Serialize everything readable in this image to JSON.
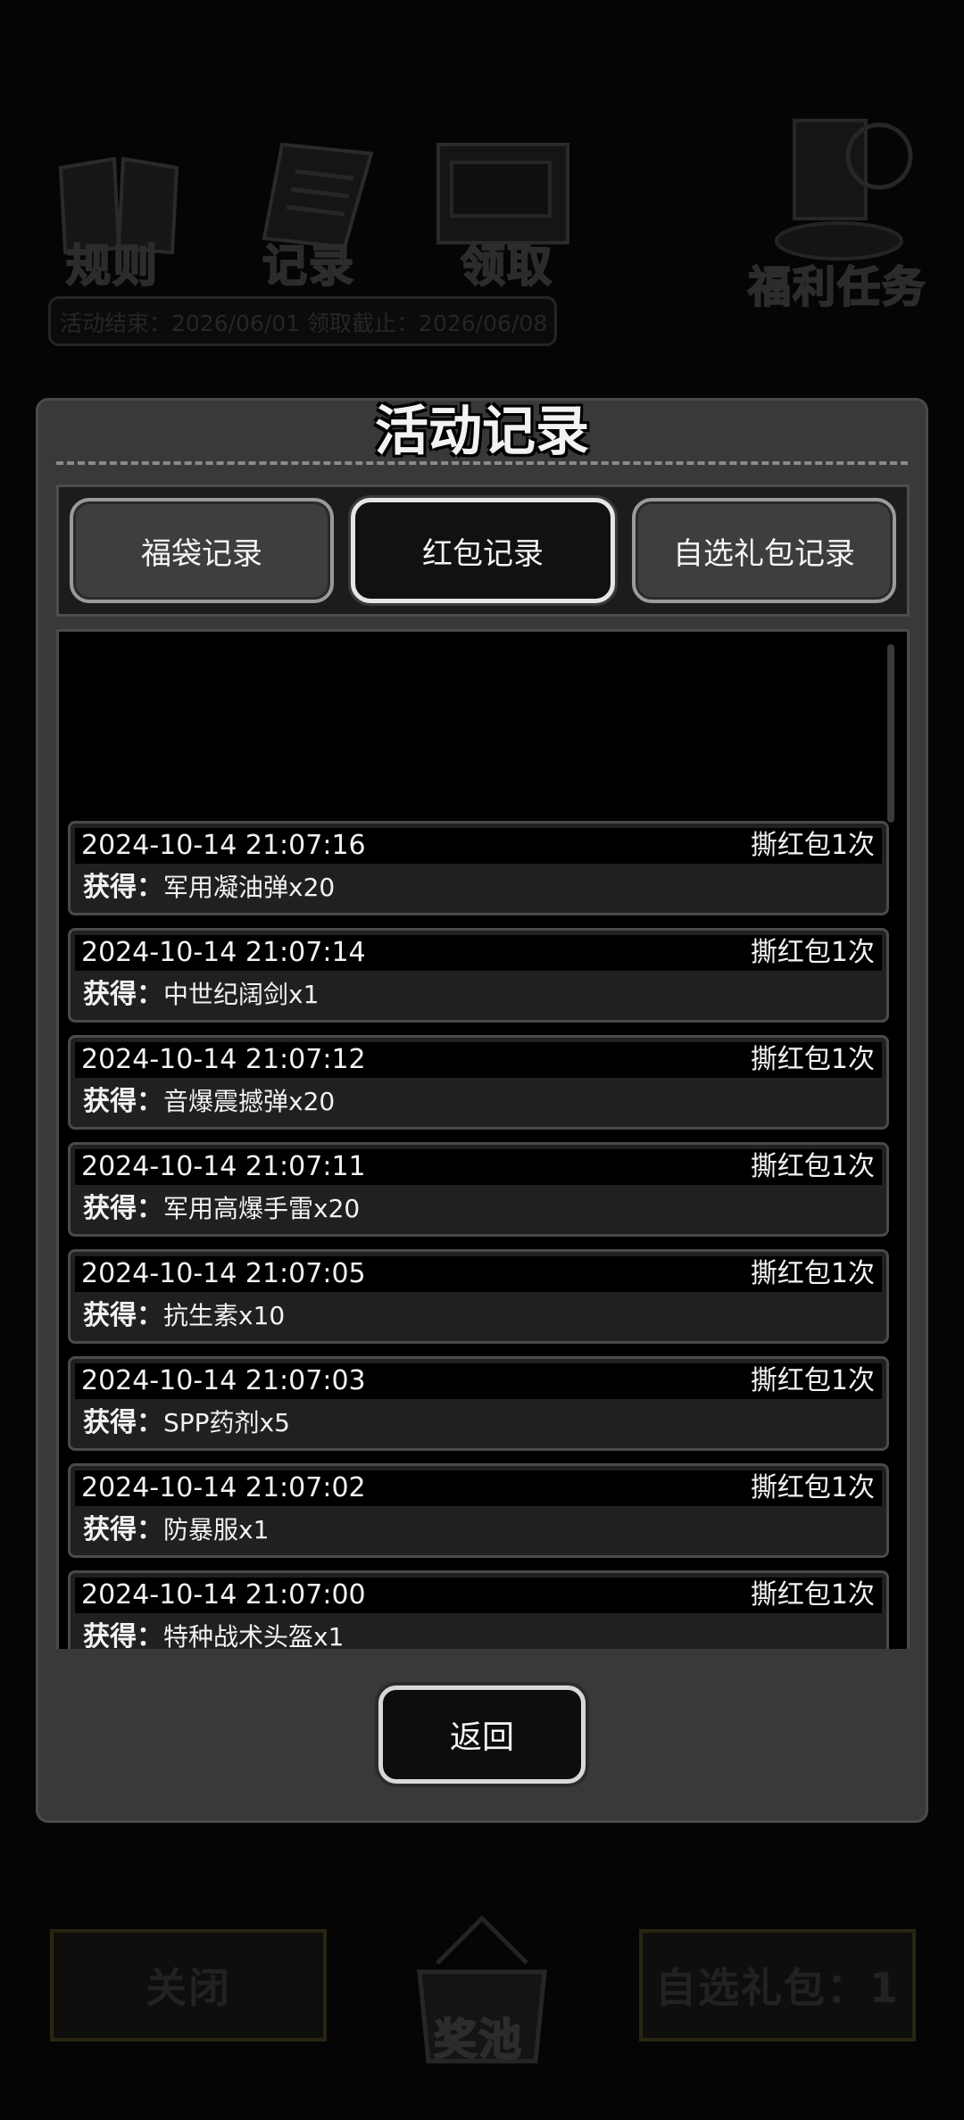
{
  "background": {
    "top_icons": [
      {
        "label": "规则",
        "icon": "book-icon"
      },
      {
        "label": "记录",
        "icon": "clipboard-icon"
      },
      {
        "label": "领取",
        "icon": "printer-icon"
      }
    ],
    "welfare_task_label": "福利任务",
    "dates_text": "活动结束：2026/06/01  领取截止：2026/06/08",
    "close_label": "关闭",
    "prize_pool_label": "奖池",
    "optional_gift_label": "自选礼包：1"
  },
  "modal": {
    "title": "活动记录",
    "tabs": [
      {
        "label": "福袋记录",
        "active": false
      },
      {
        "label": "红包记录",
        "active": true
      },
      {
        "label": "自选礼包记录",
        "active": false
      }
    ],
    "obtain_label": "获得",
    "obtain_separator": "：",
    "records": [
      {
        "time": "2024-10-14 21:07:16",
        "action": "撕红包1次",
        "item": "军用凝油弹x20"
      },
      {
        "time": "2024-10-14 21:07:14",
        "action": "撕红包1次",
        "item": "中世纪阔剑x1"
      },
      {
        "time": "2024-10-14 21:07:12",
        "action": "撕红包1次",
        "item": "音爆震撼弹x20"
      },
      {
        "time": "2024-10-14 21:07:11",
        "action": "撕红包1次",
        "item": "军用高爆手雷x20"
      },
      {
        "time": "2024-10-14 21:07:05",
        "action": "撕红包1次",
        "item": "抗生素x10"
      },
      {
        "time": "2024-10-14 21:07:03",
        "action": "撕红包1次",
        "item": "SPP药剂x5"
      },
      {
        "time": "2024-10-14 21:07:02",
        "action": "撕红包1次",
        "item": "防暴服x1"
      },
      {
        "time": "2024-10-14 21:07:00",
        "action": "撕红包1次",
        "item": "特种战术头盔x1"
      }
    ],
    "back_label": "返回"
  }
}
